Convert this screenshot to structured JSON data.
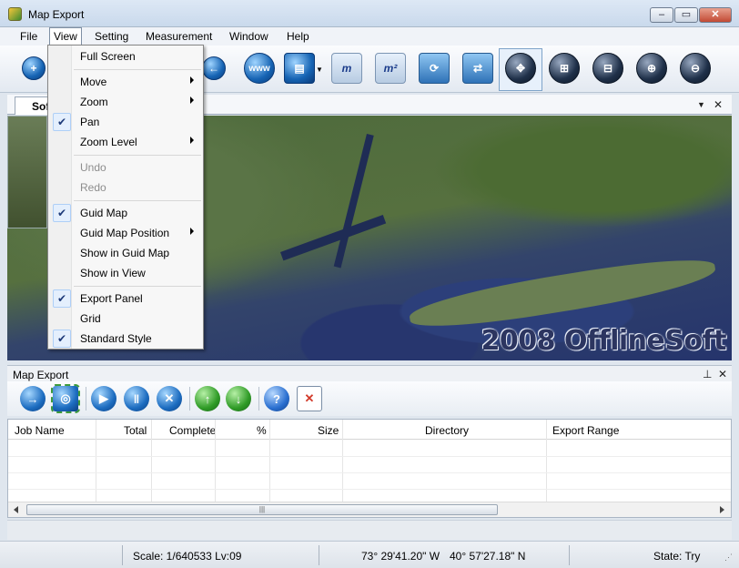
{
  "window": {
    "title": "Map Export"
  },
  "menubar": {
    "items": [
      "File",
      "View",
      "Setting",
      "Measurement",
      "Window",
      "Help"
    ]
  },
  "toolbar": {
    "tooltips": [
      "www"
    ],
    "selected_tool": "pan"
  },
  "doc_tab": {
    "label": "Sof"
  },
  "view_menu": {
    "items": [
      {
        "label": "Full Screen",
        "enabled": true,
        "checked": false,
        "submenu": false
      },
      {
        "label": "Move",
        "enabled": true,
        "checked": false,
        "submenu": true
      },
      {
        "label": "Zoom",
        "enabled": true,
        "checked": false,
        "submenu": true
      },
      {
        "label": "Pan",
        "enabled": true,
        "checked": true,
        "submenu": false
      },
      {
        "label": "Zoom Level",
        "enabled": true,
        "checked": false,
        "submenu": true
      },
      {
        "label": "Undo",
        "enabled": false,
        "checked": false,
        "submenu": false
      },
      {
        "label": "Redo",
        "enabled": false,
        "checked": false,
        "submenu": false
      },
      {
        "label": "Guid Map",
        "enabled": true,
        "checked": true,
        "submenu": false
      },
      {
        "label": "Guid Map Position",
        "enabled": true,
        "checked": false,
        "submenu": true
      },
      {
        "label": "Show in Guid Map",
        "enabled": true,
        "checked": false,
        "submenu": false
      },
      {
        "label": "Show in View",
        "enabled": true,
        "checked": false,
        "submenu": false
      },
      {
        "label": "Export Panel",
        "enabled": true,
        "checked": true,
        "submenu": false
      },
      {
        "label": "Grid",
        "enabled": true,
        "checked": false,
        "submenu": false
      },
      {
        "label": "Standard Style",
        "enabled": true,
        "checked": true,
        "submenu": false
      }
    ]
  },
  "map": {
    "watermark": "2008 OfflineSoft"
  },
  "export_panel": {
    "title": "Map Export",
    "columns": [
      "Job Name",
      "Total",
      "Complete",
      "%",
      "Size",
      "Directory",
      "Export Range"
    ],
    "rows": []
  },
  "statusbar": {
    "scale": "Scale: 1/640533 Lv:09",
    "longitude": "73°  29'41.20\" W",
    "latitude": "40°  57'27.18\" N",
    "state": "State:  Try"
  },
  "colors": {
    "accent": "#2e72b7",
    "title_bar": "#c9d9ec",
    "checked_bg": "#e4effd"
  }
}
